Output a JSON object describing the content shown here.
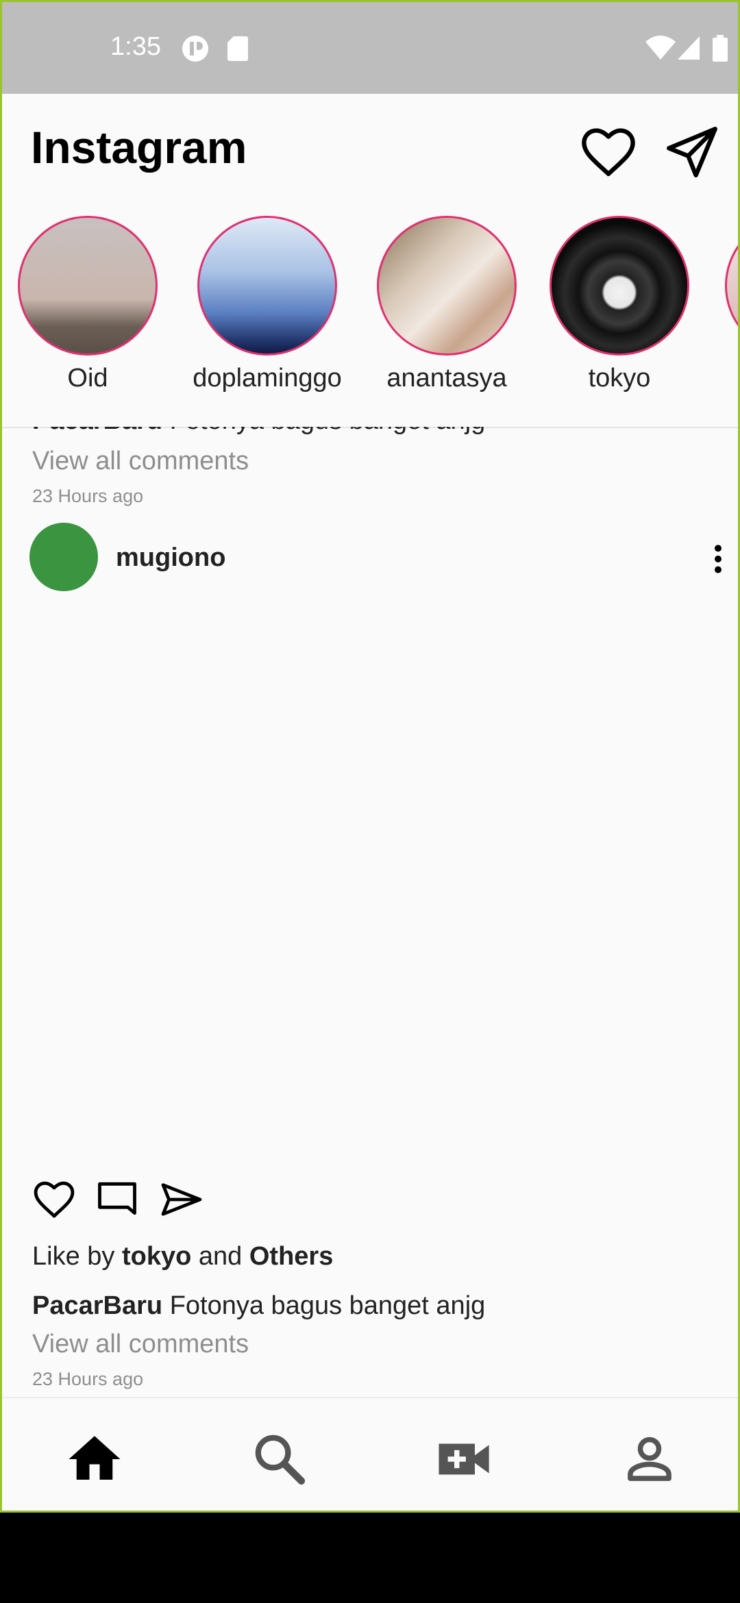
{
  "status": {
    "time": "1:35"
  },
  "app": {
    "title": "Instagram"
  },
  "stories": [
    {
      "name": "Oid"
    },
    {
      "name": "doplaminggo"
    },
    {
      "name": "anantasya"
    },
    {
      "name": "tokyo"
    }
  ],
  "prev_post": {
    "user": "PacarBaru",
    "caption": "Fotonya bagus banget anjg",
    "view_comments": "View all comments",
    "time": "23 Hours ago"
  },
  "post": {
    "user": "mugiono",
    "like_prefix": "Like by",
    "like_user": "tokyo",
    "like_and": "and",
    "like_others": "Others",
    "caption_user": "PacarBaru",
    "caption": "Fotonya bagus banget anjg",
    "view_comments": "View all comments",
    "time": "23 Hours ago"
  },
  "colors": {
    "story_ring": "#e0306e",
    "avatar": "#3a9440",
    "statusbar": "#bdbdbd"
  },
  "icons": [
    "heart-icon",
    "send-icon",
    "comment-icon",
    "more-vert-icon",
    "home-icon",
    "search-icon",
    "video-add-icon",
    "person-icon"
  ]
}
